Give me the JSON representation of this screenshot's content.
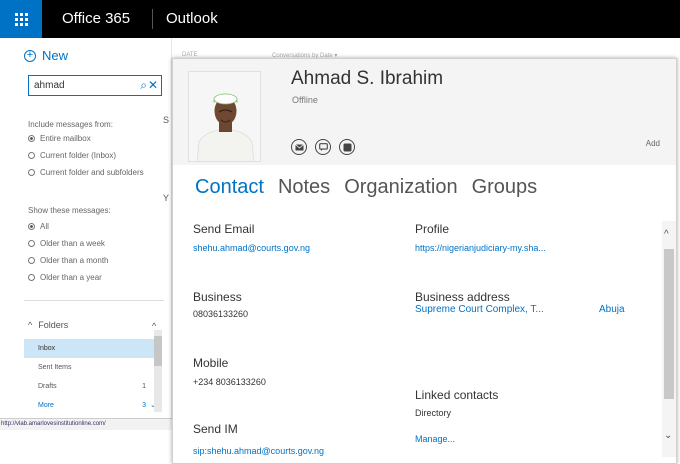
{
  "header": {
    "brand": "Office 365",
    "app": "Outlook"
  },
  "left": {
    "new_label": "New",
    "search": {
      "value": "ahmad",
      "search_icon": "⌕",
      "clear_icon": "✕"
    },
    "include_heading": "Include messages from:",
    "include_options": [
      {
        "label": "Entire mailbox",
        "selected": true
      },
      {
        "label": "Current folder (Inbox)",
        "selected": false
      },
      {
        "label": "Current folder and subfolders",
        "selected": false
      }
    ],
    "show_heading": "Show these messages:",
    "show_options": [
      {
        "label": "All",
        "selected": true
      },
      {
        "label": "Older than a week",
        "selected": false
      },
      {
        "label": "Older than a month",
        "selected": false
      },
      {
        "label": "Older than a year",
        "selected": false
      }
    ],
    "folders_label": "Folders",
    "folders": [
      {
        "label": "Inbox",
        "count": "",
        "active": true
      },
      {
        "label": "Sent Items",
        "count": "",
        "active": false
      },
      {
        "label": "Drafts",
        "count": "1",
        "active": false
      },
      {
        "label": "More",
        "count": "3",
        "active": false
      }
    ],
    "status_url": "http://vlab.amarlovesinstitutionline.com/"
  },
  "background": {
    "col1": "DATE",
    "col2": "Conversations by Date ▾",
    "frag_s": "S",
    "frag_y": "Y"
  },
  "card": {
    "name": "Ahmad S. Ibrahim",
    "presence": "Offline",
    "add_label": "Add",
    "actions": [
      "email-icon",
      "chat-icon",
      "call-icon"
    ],
    "tabs": [
      {
        "label": "Contact",
        "active": true
      },
      {
        "label": "Notes",
        "active": false
      },
      {
        "label": "Organization",
        "active": false
      },
      {
        "label": "Groups",
        "active": false
      }
    ],
    "send_email": {
      "label": "Send Email",
      "value": "shehu.ahmad@courts.gov.ng"
    },
    "profile": {
      "label": "Profile",
      "value": "https://nigerianjudiciary-my.sha..."
    },
    "business": {
      "label": "Business",
      "value": "08036133260"
    },
    "business_address": {
      "label": "Business address",
      "street": "Supreme Court Complex, T...",
      "city": "Abuja"
    },
    "mobile": {
      "label": "Mobile",
      "value": "+234 8036133260"
    },
    "linked_contacts": {
      "label": "Linked contacts",
      "source": "Directory",
      "manage": "Manage..."
    },
    "send_im": {
      "label": "Send IM",
      "value": "sip:shehu.ahmad@courts.gov.ng"
    },
    "scroll_up": "^",
    "scroll_down": "⌄"
  }
}
